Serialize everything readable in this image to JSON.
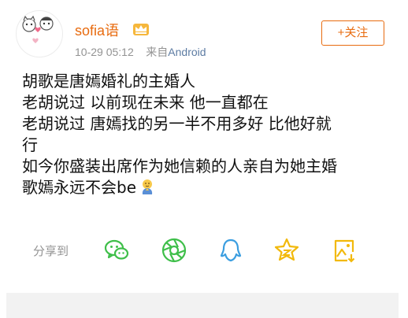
{
  "post": {
    "username": "sofia语",
    "time": "10-29 05:12",
    "source_prefix": "来自",
    "source_name": "Android",
    "follow_label": "+关注",
    "lines": [
      "胡歌是唐嫣婚礼的主婚人",
      "老胡说过 以前现在未来 他一直都在",
      "老胡说过 唐嫣找的另一半不用多好  比他好就",
      "行",
      "如今你盛装出席作为她信赖的人亲自为她主婚",
      "歌嫣永远不会be"
    ]
  },
  "share": {
    "label": "分享到",
    "targets": [
      "wechat-icon",
      "moments-icon",
      "qq-icon",
      "qzone-icon",
      "image-save-icon"
    ]
  },
  "colors": {
    "accent": "#e86b0f",
    "icon_green": "#3fbf4a",
    "icon_yellow": "#f2b90c",
    "icon_blue": "#3b9ee0",
    "meta_gray": "#939393",
    "source_blue": "#5d7ca3"
  }
}
